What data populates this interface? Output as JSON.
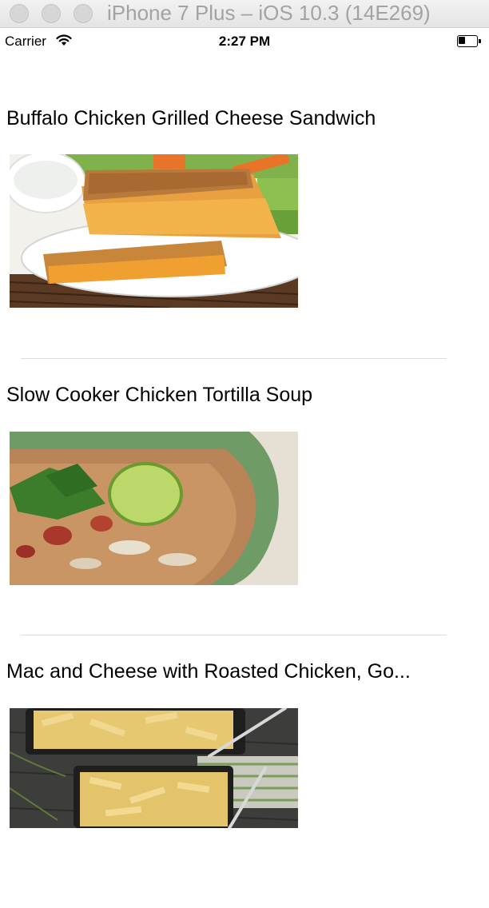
{
  "simulator": {
    "title": "iPhone 7 Plus – iOS 10.3 (14E269)"
  },
  "status_bar": {
    "carrier": "Carrier",
    "time": "2:27 PM",
    "battery_level": 0.35
  },
  "recipes": [
    {
      "title": "Buffalo Chicken Grilled Cheese Sandwich",
      "image": "grilled-cheese-sandwich-photo"
    },
    {
      "title": "Slow Cooker Chicken Tortilla Soup",
      "image": "tortilla-soup-photo"
    },
    {
      "title": "Mac and Cheese with Roasted Chicken, Go...",
      "image": "mac-and-cheese-photo"
    }
  ]
}
